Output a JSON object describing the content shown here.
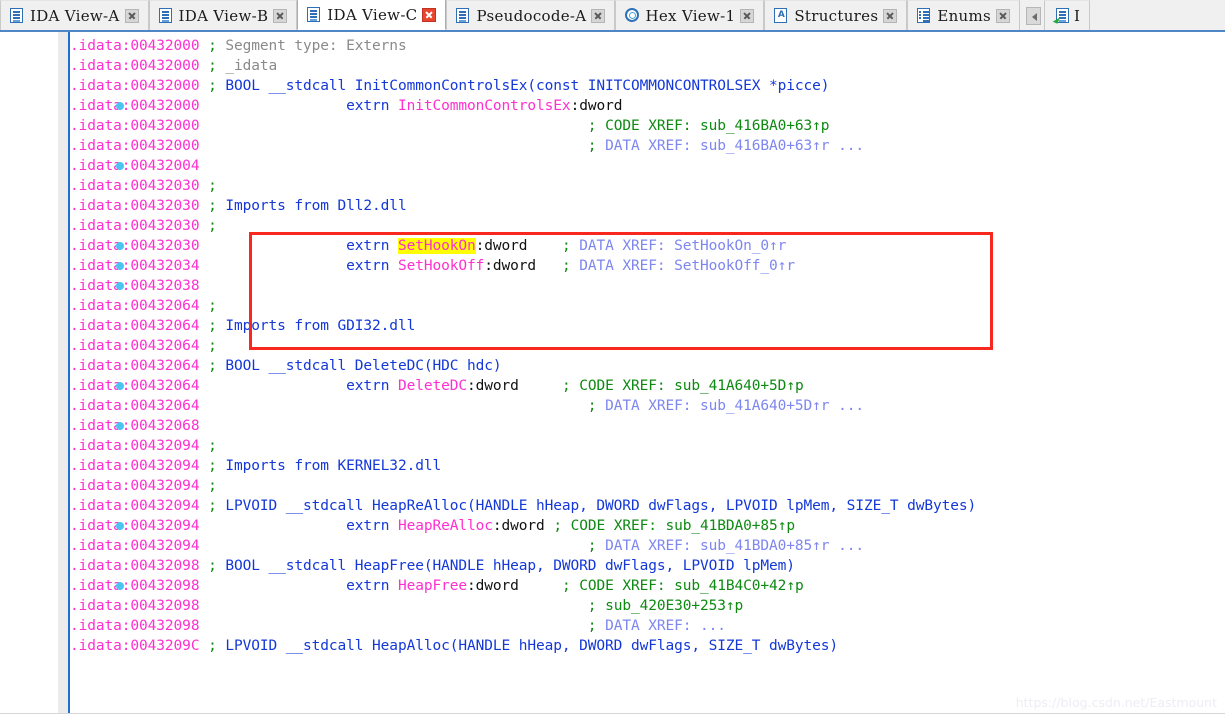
{
  "window": {
    "title": "IDA View-C",
    "watermark": "https://blog.csdn.net/Eastmount"
  },
  "colors": {
    "address": "#ff2fd0",
    "comment": "#8a8a8a",
    "keyword": "#1438d8",
    "symbol": "#ff2fd0",
    "code_xref": "#0e8a12",
    "data_xref": "#7e86ef",
    "highlight_bg": "#ffff00",
    "redbox_border": "#f8281e",
    "active_tab_accent": "#4f86c6",
    "bullet": "#4cc3f0"
  },
  "tabbar": {
    "tabs": [
      {
        "label": "IDA View-A",
        "icon": "document-icon",
        "active": false,
        "closable": true
      },
      {
        "label": "IDA View-B",
        "icon": "document-icon",
        "active": false,
        "closable": true
      },
      {
        "label": "IDA View-C",
        "icon": "document-icon",
        "active": true,
        "closable": true
      },
      {
        "label": "Pseudocode-A",
        "icon": "document-icon",
        "active": false,
        "closable": true
      },
      {
        "label": "Hex View-1",
        "icon": "hex-icon",
        "active": false,
        "closable": true
      },
      {
        "label": "Structures",
        "icon": "structures-icon",
        "active": false,
        "closable": true
      },
      {
        "label": "Enums",
        "icon": "enums-icon",
        "active": false,
        "closable": true
      },
      {
        "label": "I",
        "icon": "imports-icon",
        "active": false,
        "closable": false
      }
    ],
    "scroll_left_label": "◀"
  },
  "code": {
    "lines": [
      {
        "bullet": false,
        "addr": ".idata:00432000",
        "seg": [
          {
            "t": "semi",
            "v": " ; "
          },
          {
            "t": "cmt",
            "v": "Segment type: Externs"
          }
        ]
      },
      {
        "bullet": false,
        "addr": ".idata:00432000",
        "seg": [
          {
            "t": "semi",
            "v": " ; "
          },
          {
            "t": "cmt",
            "v": "_idata"
          }
        ]
      },
      {
        "bullet": false,
        "addr": ".idata:00432000",
        "seg": [
          {
            "t": "semi",
            "v": " ; "
          },
          {
            "t": "proto",
            "v": "BOOL __stdcall InitCommonControlsEx(const INITCOMMONCONTROLSEX *picce)"
          }
        ]
      },
      {
        "bullet": true,
        "addr": ".idata:00432000",
        "seg": [
          {
            "t": "pad",
            "v": "                 "
          },
          {
            "t": "kw",
            "v": "extrn "
          },
          {
            "t": "name",
            "v": "InitCommonControlsEx"
          },
          {
            "t": "type",
            "v": ":dword"
          }
        ]
      },
      {
        "bullet": false,
        "addr": ".idata:00432000",
        "seg": [
          {
            "t": "pad",
            "v": "                                             "
          },
          {
            "t": "semi",
            "v": "; "
          },
          {
            "t": "xcode",
            "v": "CODE XREF: sub_416BA0+63↑p"
          }
        ]
      },
      {
        "bullet": false,
        "addr": ".idata:00432000",
        "seg": [
          {
            "t": "pad",
            "v": "                                             "
          },
          {
            "t": "semi",
            "v": "; "
          },
          {
            "t": "xdata",
            "v": "DATA XREF: sub_416BA0+63↑r ..."
          }
        ]
      },
      {
        "bullet": true,
        "addr": ".idata:00432004",
        "seg": []
      },
      {
        "bullet": false,
        "addr": ".idata:00432030",
        "seg": [
          {
            "t": "semi",
            "v": " ;"
          }
        ]
      },
      {
        "bullet": false,
        "addr": ".idata:00432030",
        "seg": [
          {
            "t": "semi",
            "v": " ; "
          },
          {
            "t": "proto",
            "v": "Imports from Dll2.dll"
          }
        ]
      },
      {
        "bullet": false,
        "addr": ".idata:00432030",
        "seg": [
          {
            "t": "semi",
            "v": " ;"
          }
        ]
      },
      {
        "bullet": true,
        "addr": ".idata:00432030",
        "seg": [
          {
            "t": "pad",
            "v": "                 "
          },
          {
            "t": "kw",
            "v": "extrn "
          },
          {
            "t": "hl",
            "v": "SetHookOn"
          },
          {
            "t": "type",
            "v": ":dword"
          },
          {
            "t": "pad",
            "v": "    "
          },
          {
            "t": "semi",
            "v": "; "
          },
          {
            "t": "xdata",
            "v": "DATA XREF: SetHookOn_0↑r"
          }
        ]
      },
      {
        "bullet": true,
        "addr": ".idata:00432034",
        "seg": [
          {
            "t": "pad",
            "v": "                 "
          },
          {
            "t": "kw",
            "v": "extrn "
          },
          {
            "t": "name",
            "v": "SetHookOff"
          },
          {
            "t": "type",
            "v": ":dword"
          },
          {
            "t": "pad",
            "v": "   "
          },
          {
            "t": "semi",
            "v": "; "
          },
          {
            "t": "xdata",
            "v": "DATA XREF: SetHookOff_0↑r"
          }
        ]
      },
      {
        "bullet": true,
        "addr": ".idata:00432038",
        "seg": []
      },
      {
        "bullet": false,
        "addr": ".idata:00432064",
        "seg": [
          {
            "t": "semi",
            "v": " ;"
          }
        ]
      },
      {
        "bullet": false,
        "addr": ".idata:00432064",
        "seg": [
          {
            "t": "semi",
            "v": " ; "
          },
          {
            "t": "proto",
            "v": "Imports from GDI32.dll"
          }
        ]
      },
      {
        "bullet": false,
        "addr": ".idata:00432064",
        "seg": [
          {
            "t": "semi",
            "v": " ;"
          }
        ]
      },
      {
        "bullet": false,
        "addr": ".idata:00432064",
        "seg": [
          {
            "t": "semi",
            "v": " ; "
          },
          {
            "t": "proto",
            "v": "BOOL __stdcall DeleteDC(HDC hdc)"
          }
        ]
      },
      {
        "bullet": true,
        "addr": ".idata:00432064",
        "seg": [
          {
            "t": "pad",
            "v": "                 "
          },
          {
            "t": "kw",
            "v": "extrn "
          },
          {
            "t": "name",
            "v": "DeleteDC"
          },
          {
            "t": "type",
            "v": ":dword"
          },
          {
            "t": "pad",
            "v": "     "
          },
          {
            "t": "semi",
            "v": "; "
          },
          {
            "t": "xcode",
            "v": "CODE XREF: sub_41A640+5D↑p"
          }
        ]
      },
      {
        "bullet": false,
        "addr": ".idata:00432064",
        "seg": [
          {
            "t": "pad",
            "v": "                                             "
          },
          {
            "t": "semi",
            "v": "; "
          },
          {
            "t": "xdata",
            "v": "DATA XREF: sub_41A640+5D↑r ..."
          }
        ]
      },
      {
        "bullet": true,
        "addr": ".idata:00432068",
        "seg": []
      },
      {
        "bullet": false,
        "addr": ".idata:00432094",
        "seg": [
          {
            "t": "semi",
            "v": " ;"
          }
        ]
      },
      {
        "bullet": false,
        "addr": ".idata:00432094",
        "seg": [
          {
            "t": "semi",
            "v": " ; "
          },
          {
            "t": "proto",
            "v": "Imports from KERNEL32.dll"
          }
        ]
      },
      {
        "bullet": false,
        "addr": ".idata:00432094",
        "seg": [
          {
            "t": "semi",
            "v": " ;"
          }
        ]
      },
      {
        "bullet": false,
        "addr": ".idata:00432094",
        "seg": [
          {
            "t": "semi",
            "v": " ; "
          },
          {
            "t": "proto",
            "v": "LPVOID __stdcall HeapReAlloc(HANDLE hHeap, DWORD dwFlags, LPVOID lpMem, SIZE_T dwBytes)"
          }
        ]
      },
      {
        "bullet": true,
        "addr": ".idata:00432094",
        "seg": [
          {
            "t": "pad",
            "v": "                 "
          },
          {
            "t": "kw",
            "v": "extrn "
          },
          {
            "t": "name",
            "v": "HeapReAlloc"
          },
          {
            "t": "type",
            "v": ":dword"
          },
          {
            "t": "pad",
            "v": " "
          },
          {
            "t": "semi",
            "v": "; "
          },
          {
            "t": "xcode",
            "v": "CODE XREF: sub_41BDA0+85↑p"
          }
        ]
      },
      {
        "bullet": false,
        "addr": ".idata:00432094",
        "seg": [
          {
            "t": "pad",
            "v": "                                             "
          },
          {
            "t": "semi",
            "v": "; "
          },
          {
            "t": "xdata",
            "v": "DATA XREF: sub_41BDA0+85↑r ..."
          }
        ]
      },
      {
        "bullet": false,
        "addr": ".idata:00432098",
        "seg": [
          {
            "t": "semi",
            "v": " ; "
          },
          {
            "t": "proto",
            "v": "BOOL __stdcall HeapFree(HANDLE hHeap, DWORD dwFlags, LPVOID lpMem)"
          }
        ]
      },
      {
        "bullet": true,
        "addr": ".idata:00432098",
        "seg": [
          {
            "t": "pad",
            "v": "                 "
          },
          {
            "t": "kw",
            "v": "extrn "
          },
          {
            "t": "name",
            "v": "HeapFree"
          },
          {
            "t": "type",
            "v": ":dword"
          },
          {
            "t": "pad",
            "v": "     "
          },
          {
            "t": "semi",
            "v": "; "
          },
          {
            "t": "xcode",
            "v": "CODE XREF: sub_41B4C0+42↑p"
          }
        ]
      },
      {
        "bullet": false,
        "addr": ".idata:00432098",
        "seg": [
          {
            "t": "pad",
            "v": "                                             "
          },
          {
            "t": "semi",
            "v": "; "
          },
          {
            "t": "xcode",
            "v": "sub_420E30+253↑p"
          }
        ]
      },
      {
        "bullet": false,
        "addr": ".idata:00432098",
        "seg": [
          {
            "t": "pad",
            "v": "                                             "
          },
          {
            "t": "semi",
            "v": "; "
          },
          {
            "t": "xdata",
            "v": "DATA XREF: ..."
          }
        ]
      },
      {
        "bullet": false,
        "addr": ".idata:0043209C",
        "seg": [
          {
            "t": "semi",
            "v": " ; "
          },
          {
            "t": "proto",
            "v": "LPVOID __stdcall HeapAlloc(HANDLE hHeap, DWORD dwFlags, SIZE_T dwBytes)"
          }
        ]
      }
    ]
  },
  "annotation": {
    "redbox_label": "Imports from Dll2.dll highlight"
  }
}
